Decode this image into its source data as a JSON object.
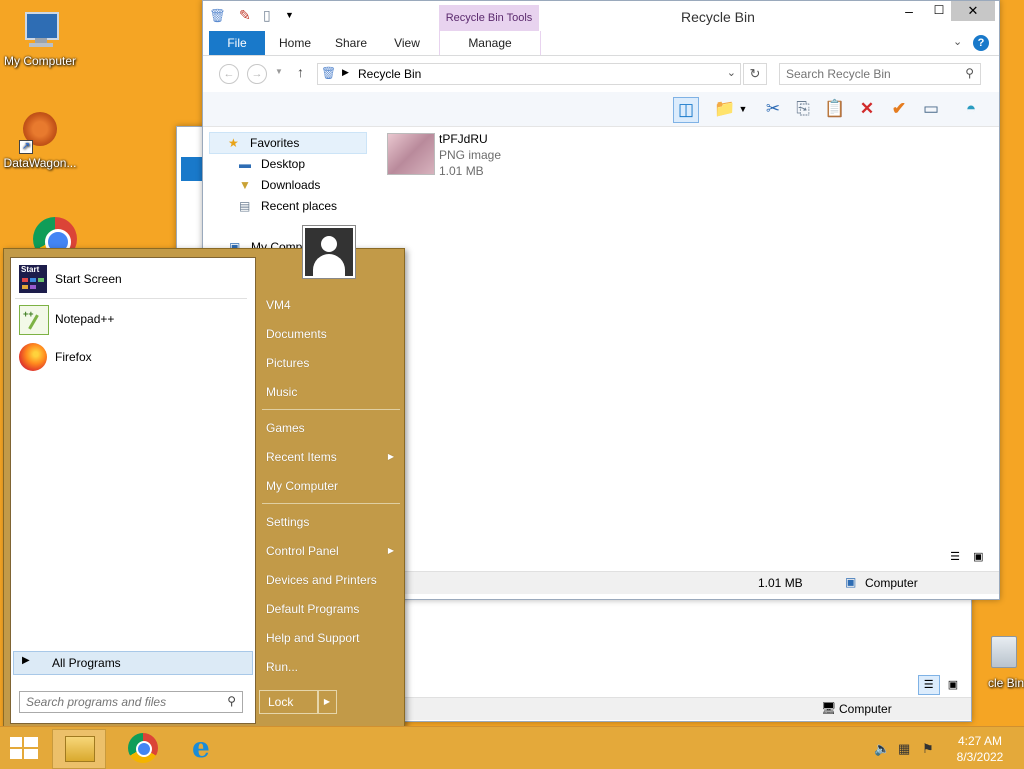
{
  "desktop": {
    "icons": [
      {
        "label": "My Computer"
      },
      {
        "label": "DataWagon..."
      },
      {
        "label": ""
      },
      {
        "label": "cle Bin"
      }
    ]
  },
  "explorer": {
    "title": "Recycle Bin",
    "context_tab": "Recycle Bin Tools",
    "tabs": {
      "file": "File",
      "home": "Home",
      "share": "Share",
      "view": "View",
      "manage": "Manage"
    },
    "address": "Recycle Bin",
    "search_placeholder": "Search Recycle Bin",
    "nav_pane": {
      "favorites": "Favorites",
      "items": [
        "Desktop",
        "Downloads",
        "Recent places"
      ],
      "computer": "My Comp"
    },
    "file": {
      "name": "tPFJdRU",
      "type": "PNG image",
      "size": "1.01 MB"
    },
    "status": {
      "size": "1.01 MB",
      "location": "Computer"
    }
  },
  "back_window": {
    "status_location": "Computer"
  },
  "start_menu": {
    "programs": [
      {
        "label": "Start Screen",
        "icon": "start-screen-icon"
      },
      {
        "label": "Notepad++",
        "icon": "notepadpp-icon"
      },
      {
        "label": "Firefox",
        "icon": "firefox-icon"
      }
    ],
    "all_programs": "All Programs",
    "search_placeholder": "Search programs and files",
    "right_items": [
      {
        "label": "VM4"
      },
      {
        "label": "Documents"
      },
      {
        "label": "Pictures"
      },
      {
        "label": "Music"
      },
      {
        "label": "Games"
      },
      {
        "label": "Recent Items"
      },
      {
        "label": "My Computer"
      },
      {
        "label": "Settings"
      },
      {
        "label": "Control Panel"
      },
      {
        "label": "Devices and Printers"
      },
      {
        "label": "Default Programs"
      },
      {
        "label": "Help and Support"
      },
      {
        "label": "Run..."
      }
    ],
    "lock": "Lock"
  },
  "taskbar": {
    "time": "4:27 AM",
    "date": "8/3/2022"
  },
  "colors": {
    "desktop": "#F5A524",
    "start_menu": "#C29A48",
    "file_tab": "#1979CA",
    "context_tab": "#E8D3EF"
  }
}
